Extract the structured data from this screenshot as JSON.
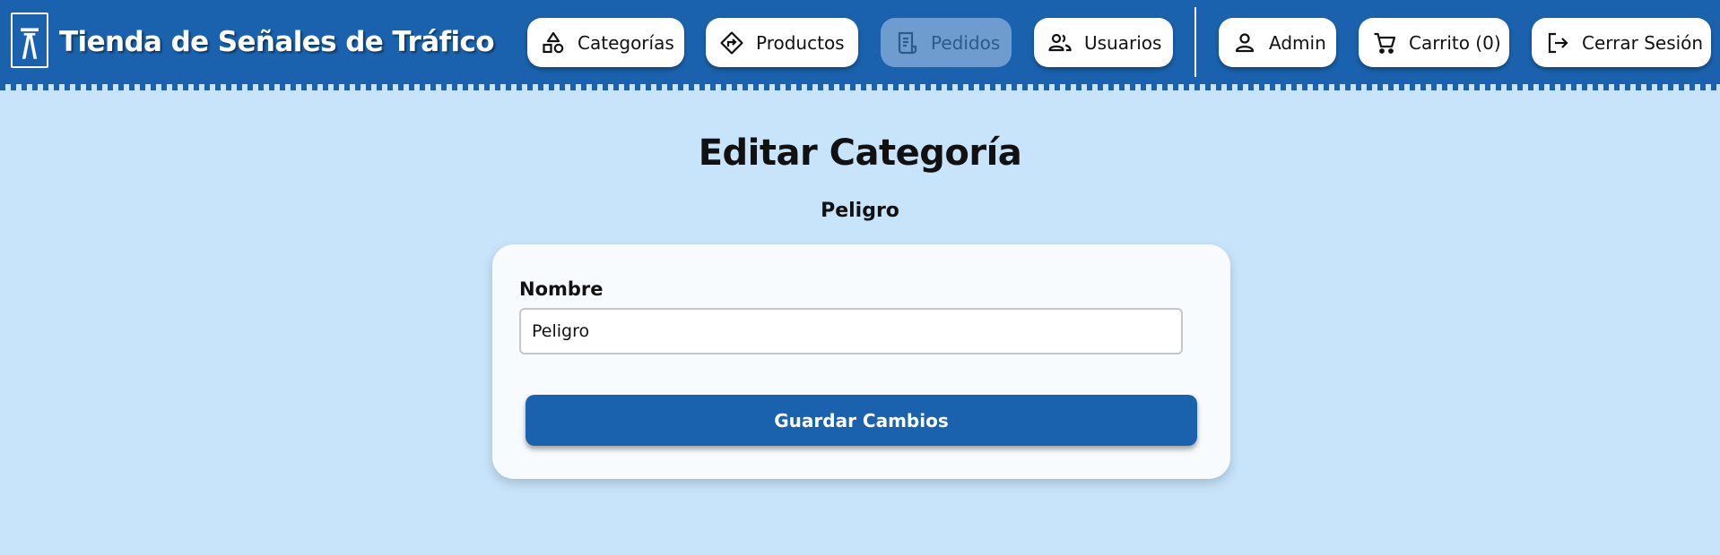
{
  "header": {
    "brand_title": "Tienda de Señales de Tráfico",
    "logo_icon": "motorway-sign-icon",
    "bg_color": "#1a62ae"
  },
  "nav": {
    "categorias": {
      "label": "Categorías",
      "icon": "shapes-icon"
    },
    "productos": {
      "label": "Productos",
      "icon": "directions-sign-icon"
    },
    "pedidos": {
      "label": "Pedidos",
      "icon": "receipt-icon",
      "state": "disabled"
    },
    "usuarios": {
      "label": "Usuarios",
      "icon": "users-icon"
    },
    "admin": {
      "label": "Admin",
      "icon": "user-icon"
    },
    "carrito": {
      "label": "Carrito (0)",
      "icon": "cart-icon"
    },
    "logout": {
      "label": "Cerrar Sesión",
      "icon": "logout-icon"
    }
  },
  "main": {
    "title": "Editar Categoría",
    "subtitle": "Peligro",
    "form": {
      "nombre_label": "Nombre",
      "nombre_value": "Peligro",
      "submit_label": "Guardar Cambios"
    }
  },
  "colors": {
    "primary": "#1a62ae",
    "page_bg": "#c8e4fb",
    "card_bg": "#f7fbfe"
  }
}
